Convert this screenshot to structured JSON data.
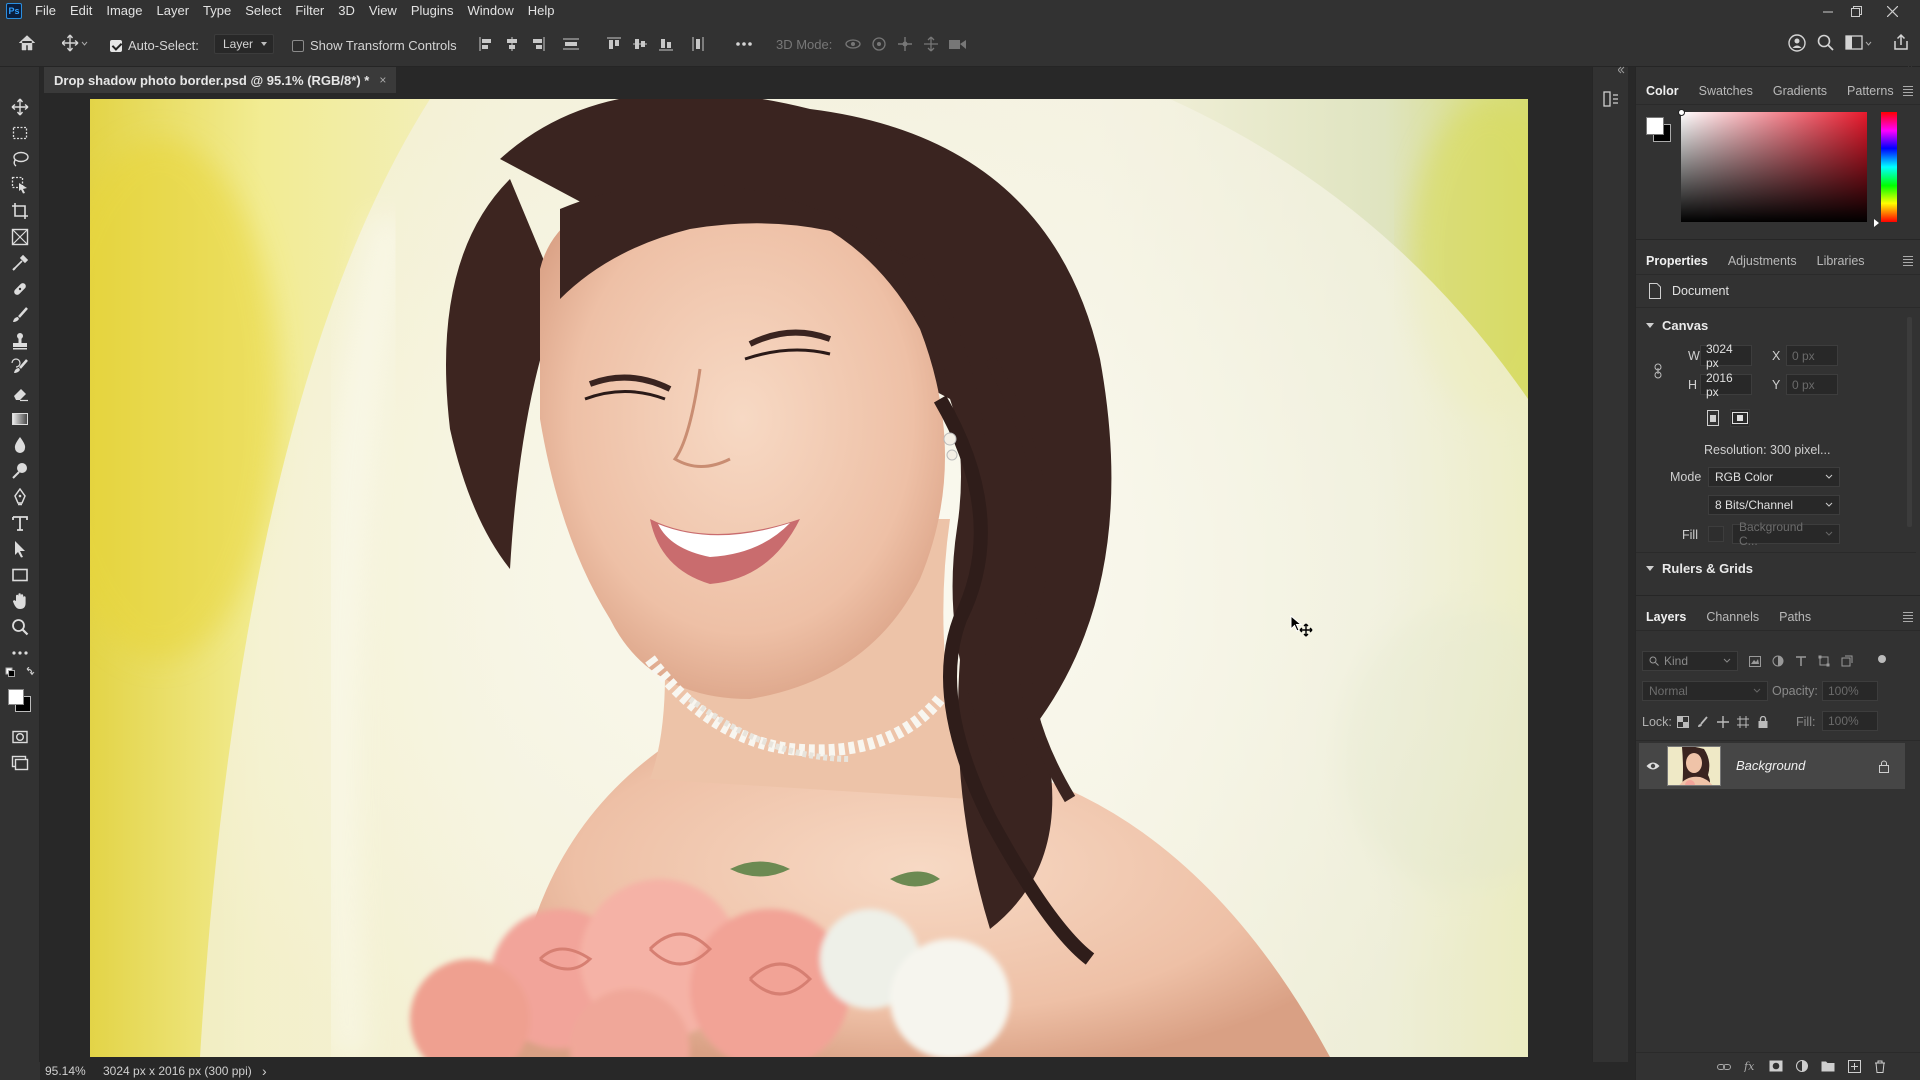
{
  "app": {
    "logo_text": "Ps"
  },
  "menu": [
    "File",
    "Edit",
    "Image",
    "Layer",
    "Type",
    "Select",
    "Filter",
    "3D",
    "View",
    "Plugins",
    "Window",
    "Help"
  ],
  "options_bar": {
    "auto_select_label": "Auto-Select:",
    "auto_select_checked": true,
    "auto_select_target": "Layer",
    "show_transform_label": "Show Transform Controls",
    "show_transform_checked": false,
    "three_d_mode_label": "3D Mode:"
  },
  "document": {
    "tab_title": "Drop shadow photo border.psd @ 95.1% (RGB/8*) *",
    "close_glyph": "×"
  },
  "status_bar": {
    "zoom": "95.14%",
    "doc_info": "3024 px x 2016 px (300 ppi)",
    "arrow": "›"
  },
  "color_panel": {
    "tabs": [
      "Color",
      "Swatches",
      "Gradients",
      "Patterns"
    ],
    "active_tab": "Color",
    "foreground": "#ffffff",
    "background": "#000000",
    "hue_color": "#e8192c"
  },
  "properties_panel": {
    "tabs": [
      "Properties",
      "Adjustments",
      "Libraries"
    ],
    "active_tab": "Properties",
    "doc_label": "Document",
    "canvas": {
      "title": "Canvas",
      "w_label": "W",
      "w_value": "3024 px",
      "h_label": "H",
      "h_value": "2016 px",
      "x_label": "X",
      "x_placeholder": "0 px",
      "y_label": "Y",
      "y_placeholder": "0 px",
      "resolution": "Resolution: 300 pixel...",
      "mode_label": "Mode",
      "mode_value": "RGB Color",
      "bits_value": "8 Bits/Channel",
      "fill_label": "Fill",
      "fill_value": "Background C..."
    },
    "rulers_title": "Rulers & Grids"
  },
  "layers_panel": {
    "tabs": [
      "Layers",
      "Channels",
      "Paths"
    ],
    "active_tab": "Layers",
    "kind_placeholder": "Kind",
    "blend_mode": "Normal",
    "opacity_label": "Opacity:",
    "opacity_value": "100%",
    "lock_label": "Lock:",
    "fill_label": "Fill:",
    "fill_value": "100%",
    "layers": [
      {
        "name": "Background",
        "visible": true,
        "locked": true
      }
    ]
  }
}
